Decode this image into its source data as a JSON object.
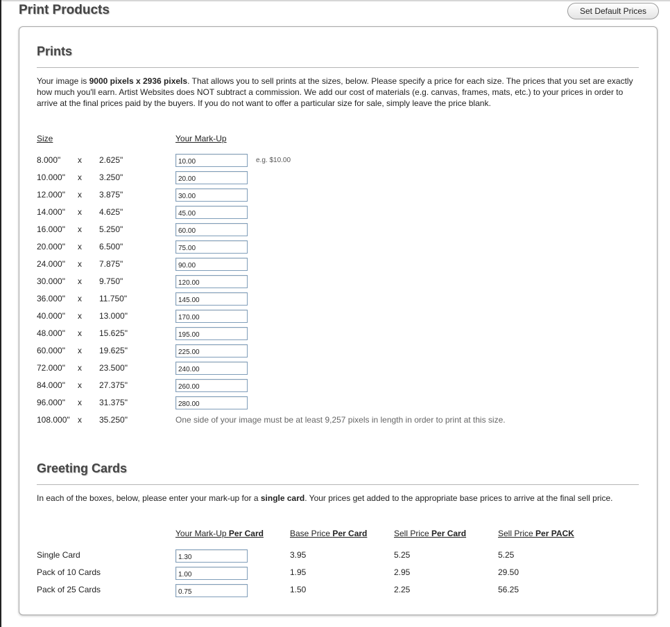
{
  "header": {
    "title": "Print Products",
    "default_prices_label": "Set Default Prices"
  },
  "prints": {
    "title": "Prints",
    "intro_1": "Your image is ",
    "intro_bold": "9000 pixels x 2936 pixels",
    "intro_2": ".  That allows you to sell prints at the sizes, below.  Please specify a price for each size.  The prices that you set are exactly how much you'll earn.  Artist Websites does NOT subtract a commission.  We add our cost of materials (e.g. canvas, frames, mats, etc.) to your prices in order to arrive at the final prices paid by the buyers.  If you do not want to offer a particular size for sale, simply leave the price blank.",
    "size_header": "Size",
    "markup_header": "Your Mark-Up",
    "example_hint": "e.g. $10.00",
    "times": "x",
    "rows": [
      {
        "w": "8.000\"",
        "h": "2.625\"",
        "price": "10.00"
      },
      {
        "w": "10.000\"",
        "h": "3.250\"",
        "price": "20.00"
      },
      {
        "w": "12.000\"",
        "h": "3.875\"",
        "price": "30.00"
      },
      {
        "w": "14.000\"",
        "h": "4.625\"",
        "price": "45.00"
      },
      {
        "w": "16.000\"",
        "h": "5.250\"",
        "price": "60.00"
      },
      {
        "w": "20.000\"",
        "h": "6.500\"",
        "price": "75.00"
      },
      {
        "w": "24.000\"",
        "h": "7.875\"",
        "price": "90.00"
      },
      {
        "w": "30.000\"",
        "h": "9.750\"",
        "price": "120.00"
      },
      {
        "w": "36.000\"",
        "h": "11.750\"",
        "price": "145.00"
      },
      {
        "w": "40.000\"",
        "h": "13.000\"",
        "price": "170.00"
      },
      {
        "w": "48.000\"",
        "h": "15.625\"",
        "price": "195.00"
      },
      {
        "w": "60.000\"",
        "h": "19.625\"",
        "price": "225.00"
      },
      {
        "w": "72.000\"",
        "h": "23.500\"",
        "price": "240.00"
      },
      {
        "w": "84.000\"",
        "h": "27.375\"",
        "price": "260.00"
      },
      {
        "w": "96.000\"",
        "h": "31.375\"",
        "price": "280.00"
      }
    ],
    "last_row": {
      "w": "108.000\"",
      "h": "35.250\"",
      "note": "One side of your image must be at least 9,257 pixels in length in order to print at this size."
    }
  },
  "cards": {
    "title": "Greeting Cards",
    "intro_1": "In each of the boxes, below, please enter your mark-up for a ",
    "intro_bold": "single card",
    "intro_2": ".  Your prices get added to the appropriate base prices to arrive at the final sell price.",
    "headers": {
      "markup": "Your Mark-Up ",
      "markup_bold": "Per Card",
      "base": "Base Price ",
      "base_bold": "Per Card",
      "sell": "Sell Price ",
      "sell_bold": "Per Card",
      "pack": "Sell Price ",
      "pack_bold": "Per PACK"
    },
    "rows": [
      {
        "label": "Single Card",
        "markup": "1.30",
        "base": "3.95",
        "sell": "5.25",
        "pack": "5.25"
      },
      {
        "label": "Pack of 10 Cards",
        "markup": "1.00",
        "base": "1.95",
        "sell": "2.95",
        "pack": "29.50"
      },
      {
        "label": "Pack of 25 Cards",
        "markup": "0.75",
        "base": "1.50",
        "sell": "2.25",
        "pack": "56.25"
      }
    ]
  }
}
